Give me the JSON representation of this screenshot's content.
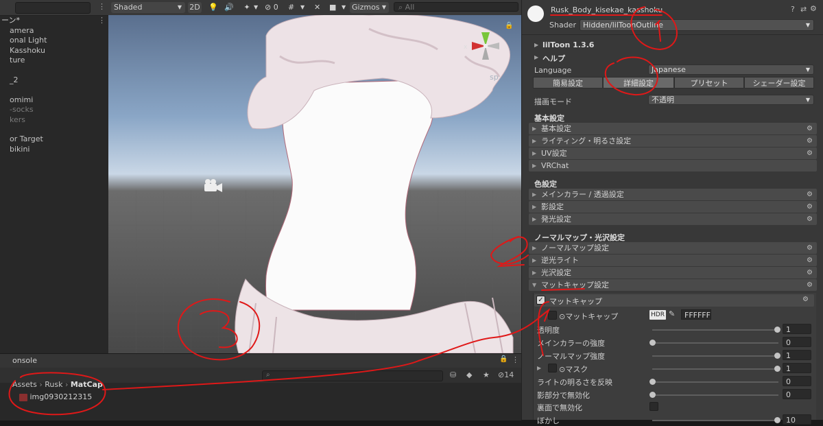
{
  "hierarchy": {
    "title": "ーン*",
    "items": [
      {
        "label": "amera",
        "dim": false
      },
      {
        "label": "onal Light",
        "dim": false
      },
      {
        "label": "Kasshoku",
        "dim": false
      },
      {
        "label": "ture",
        "dim": false
      },
      {
        "label": "",
        "dim": false
      },
      {
        "label": "_2",
        "dim": false
      },
      {
        "label": "",
        "dim": false
      },
      {
        "label": "omimi",
        "dim": false
      },
      {
        "label": "-socks",
        "dim": true
      },
      {
        "label": "kers",
        "dim": true
      },
      {
        "label": "",
        "dim": false
      },
      {
        "label": "or Target",
        "dim": false
      },
      {
        "label": "bikini",
        "dim": false
      }
    ]
  },
  "scene_toolbar": {
    "draw_mode": "Shaded",
    "twod": "2D",
    "gizmos": "Gizmos",
    "search_label": "All",
    "hidden_count": "0",
    "persp": "sp"
  },
  "console": {
    "tab_label": "onsole",
    "hidden_count": "14",
    "breadcrumb": [
      "Assets",
      "Rusk",
      "MatCap"
    ],
    "file": "img0930212315"
  },
  "inspector": {
    "object_name": "Rusk_Body_kisekae_kasshoku",
    "shader_label": "Shader",
    "shader_value": "Hidden/lilToonOutline",
    "liltoon_version": "lilToon 1.3.6",
    "help": "ヘルプ",
    "language_label": "Language",
    "language_value": "Japanese",
    "tabs": [
      "簡易設定",
      "詳細設定",
      "プリセット",
      "シェーダー設定"
    ],
    "render_mode_label": "描画モード",
    "render_mode_value": "不透明",
    "cat_basic": "基本設定",
    "basic_sections": [
      "基本設定",
      "ライティング・明るさ設定",
      "UV設定",
      "VRChat"
    ],
    "cat_color": "色設定",
    "color_sections": [
      "メインカラー / 透過設定",
      "影設定",
      "発光設定"
    ],
    "cat_normal": "ノーマルマップ・光沢設定",
    "normal_sections": [
      "ノーマルマップ設定",
      "逆光ライト",
      "光沢設定",
      "マットキャップ設定"
    ],
    "matcap_toggle": "マットキャップ",
    "matcap_tex_label": "⊙マットキャップ",
    "hdr": "HDR",
    "color_hex": "FFFFFF",
    "props": [
      {
        "label": "透明度",
        "value": "1",
        "frac": 1
      },
      {
        "label": "メインカラーの強度",
        "value": "0",
        "frac": 0
      },
      {
        "label": "ノーマルマップ強度",
        "value": "1",
        "frac": 1
      },
      {
        "label": "⊙マスク",
        "value": "1",
        "frac": 1
      },
      {
        "label": "ライトの明るさを反映",
        "value": "0",
        "frac": 0
      },
      {
        "label": "影部分で無効化",
        "value": "0",
        "frac": 0
      },
      {
        "label": "裏面で無効化",
        "value": "",
        "frac": null
      },
      {
        "label": "ぼかし",
        "value": "10",
        "frac": 1
      }
    ]
  },
  "annotations": [
    "1",
    "2",
    "3"
  ],
  "colors": {
    "annotation": "#e01818",
    "bg": "#383838",
    "section": "#4a4a4a"
  }
}
